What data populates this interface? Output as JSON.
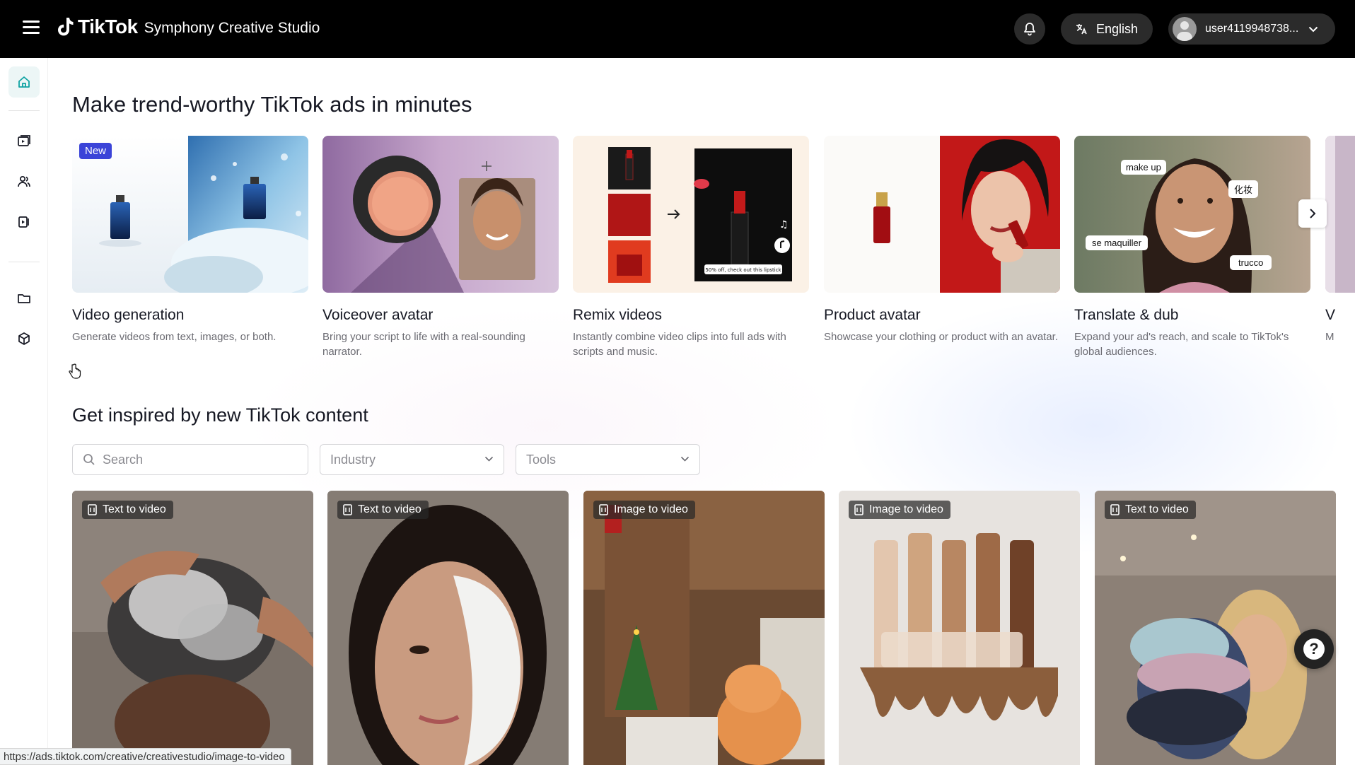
{
  "header": {
    "brand": "TikTok",
    "product": "Symphony Creative Studio",
    "language": "English",
    "username": "user4119948738..."
  },
  "sidebar": {
    "items": [
      "home-icon",
      "video-library-icon",
      "users-icon",
      "video-edit-icon",
      "folder-icon",
      "box-icon"
    ]
  },
  "hero": {
    "title": "Make trend-worthy TikTok ads in minutes"
  },
  "features": [
    {
      "title": "Video generation",
      "description": "Generate videos from text, images, or both.",
      "badge": "New"
    },
    {
      "title": "Voiceover avatar",
      "description": "Bring your script to life with a real-sounding narrator."
    },
    {
      "title": "Remix videos",
      "description": "Instantly combine video clips into full ads with scripts and music.",
      "overlay_text": "50% off, check out this lipstick"
    },
    {
      "title": "Product avatar",
      "description": "Showcase your clothing or product with an avatar."
    },
    {
      "title": "Translate & dub",
      "description": "Expand your ad's reach, and scale to TikTok's global audiences.",
      "chips": [
        "make up",
        "化妆",
        "se maquiller",
        "trucco"
      ]
    },
    {
      "title": "V",
      "description": "M"
    }
  ],
  "inspire": {
    "title": "Get inspired by new TikTok content",
    "search_placeholder": "Search",
    "industry_placeholder": "Industry",
    "tools_placeholder": "Tools",
    "tiles": [
      {
        "badge": "Text to video"
      },
      {
        "badge": "Text to video"
      },
      {
        "badge": "Image to video"
      },
      {
        "badge": "Image to video"
      },
      {
        "badge": "Text to video"
      }
    ]
  },
  "help": {
    "label": "?"
  },
  "status_url": "https://ads.tiktok.com/creative/creativestudio/image-to-video",
  "colors": {
    "accent": "#3b44d8",
    "header_bg": "#000000",
    "sidebar_active": "#0fa3a3"
  }
}
